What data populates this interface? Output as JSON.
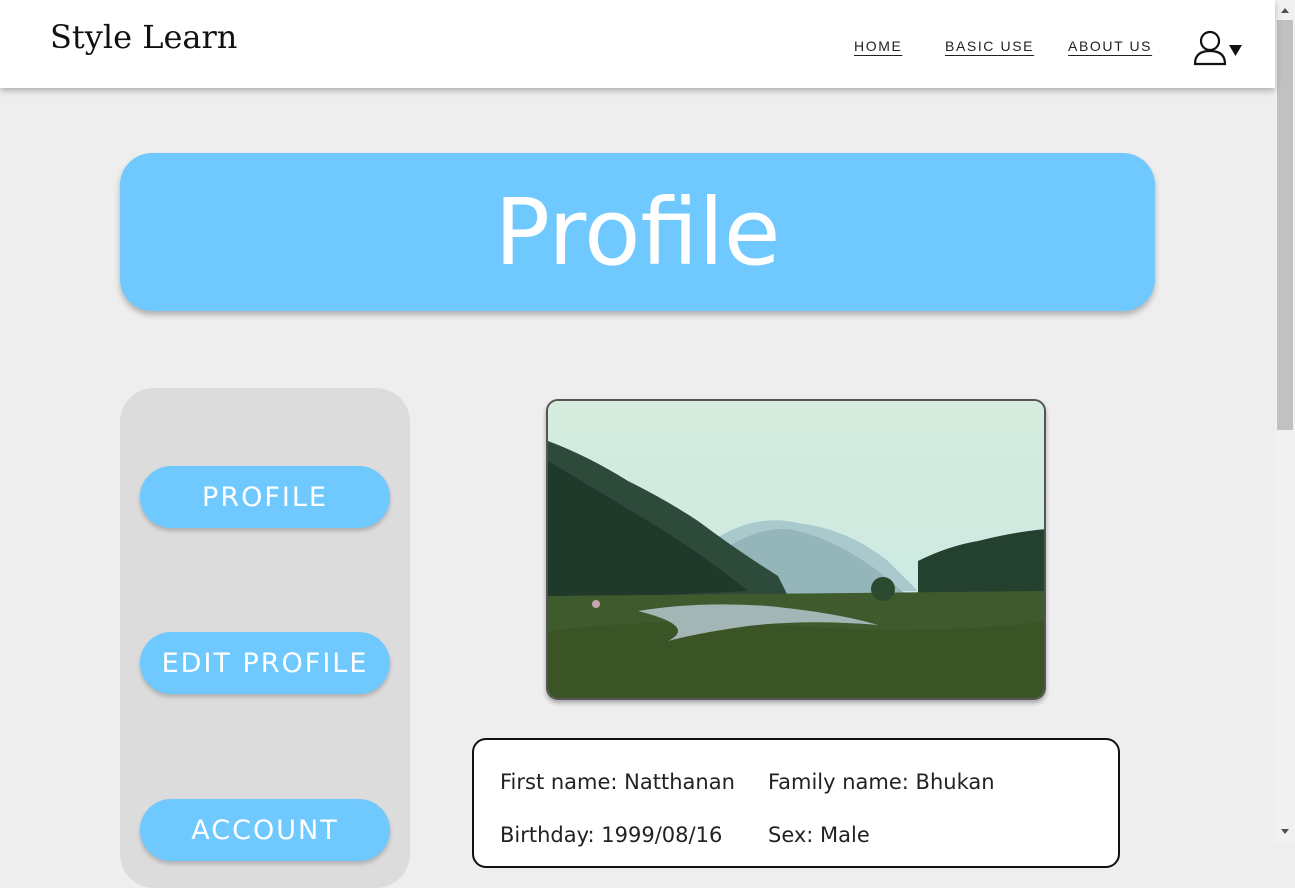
{
  "header": {
    "logo_text": "Style Learn",
    "nav": [
      {
        "label": "HOME"
      },
      {
        "label": "BASIC USE"
      },
      {
        "label": "ABOUT US"
      }
    ],
    "user_icon": "user-icon",
    "dropdown_icon": "caret-down-icon"
  },
  "banner": {
    "title": "Profile"
  },
  "sidebar": {
    "buttons": [
      {
        "label": "PROFILE"
      },
      {
        "label": "EDIT PROFILE"
      },
      {
        "label": "ACCOUNT"
      }
    ]
  },
  "profile": {
    "first_name": "First name: Natthanan",
    "family_name": "Family name: Bhukan",
    "birthday": "Birthday: 1999/08/16",
    "sex": "Sex: Male"
  },
  "colors": {
    "accent": "#70c9fe",
    "background": "#eeeeee",
    "panel": "#dcdcdc"
  }
}
